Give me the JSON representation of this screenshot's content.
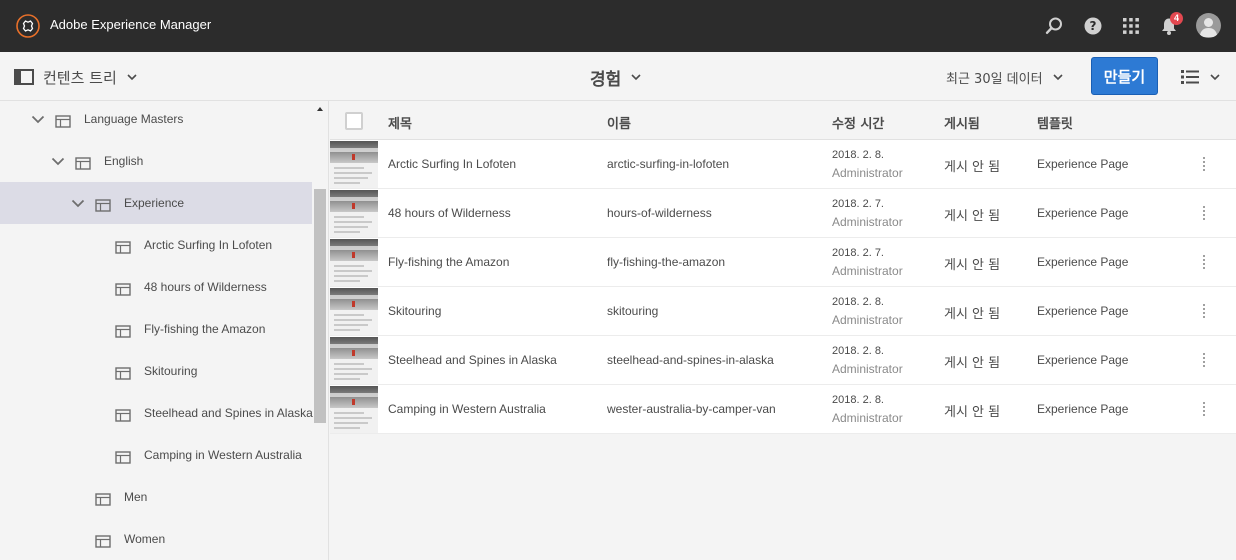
{
  "header": {
    "app_title": "Adobe Experience Manager",
    "notification_count": "4",
    "icons": [
      "aem-logo-icon",
      "search-icon",
      "help-icon",
      "solutions-grid-icon",
      "bell-icon",
      "user-avatar"
    ]
  },
  "actionbar": {
    "rail_label": "컨텐츠 트리",
    "breadcrumb_label": "경험",
    "filter_label": "최근 30일 데이터",
    "create_label": "만들기",
    "view_icon": "list-view-icon"
  },
  "tree": [
    {
      "label": "Language Masters",
      "level": 1,
      "expanded": true
    },
    {
      "label": "English",
      "level": 2,
      "expanded": true
    },
    {
      "label": "Experience",
      "level": 3,
      "expanded": true,
      "selected": true
    },
    {
      "label": "Arctic Surfing In Lofoten",
      "level": 4
    },
    {
      "label": "48 hours of Wilderness",
      "level": 4
    },
    {
      "label": "Fly-fishing the Amazon",
      "level": 4
    },
    {
      "label": "Skitouring",
      "level": 4
    },
    {
      "label": "Steelhead and Spines in Alaska",
      "level": 4
    },
    {
      "label": "Camping in Western Australia",
      "level": 4
    },
    {
      "label": "Men",
      "level": 3
    },
    {
      "label": "Women",
      "level": 3
    }
  ],
  "columns": {
    "title": "제목",
    "name": "이름",
    "modified": "수정 시간",
    "published": "게시됨",
    "template": "템플릿"
  },
  "rows": [
    {
      "title": "Arctic Surfing In Lofoten",
      "name": "arctic-surfing-in-lofoten",
      "date": "2018. 2. 8.",
      "author": "Administrator",
      "published": "게시 안 됨",
      "template": "Experience Page"
    },
    {
      "title": "48 hours of Wilderness",
      "name": "hours-of-wilderness",
      "date": "2018. 2. 7.",
      "author": "Administrator",
      "published": "게시 안 됨",
      "template": "Experience Page"
    },
    {
      "title": "Fly-fishing the Amazon",
      "name": "fly-fishing-the-amazon",
      "date": "2018. 2. 7.",
      "author": "Administrator",
      "published": "게시 안 됨",
      "template": "Experience Page"
    },
    {
      "title": "Skitouring",
      "name": "skitouring",
      "date": "2018. 2. 8.",
      "author": "Administrator",
      "published": "게시 안 됨",
      "template": "Experience Page"
    },
    {
      "title": "Steelhead and Spines in Alaska",
      "name": "steelhead-and-spines-in-alaska",
      "date": "2018. 2. 8.",
      "author": "Administrator",
      "published": "게시 안 됨",
      "template": "Experience Page"
    },
    {
      "title": "Camping in Western Australia",
      "name": "wester-australia-by-camper-van",
      "date": "2018. 2. 8.",
      "author": "Administrator",
      "published": "게시 안 됨",
      "template": "Experience Page"
    }
  ],
  "colors": {
    "header_bg": "#2c2c2c",
    "accent": "#2d7ad4",
    "selected_bg": "#dcdce6",
    "badge": "#e34850"
  }
}
